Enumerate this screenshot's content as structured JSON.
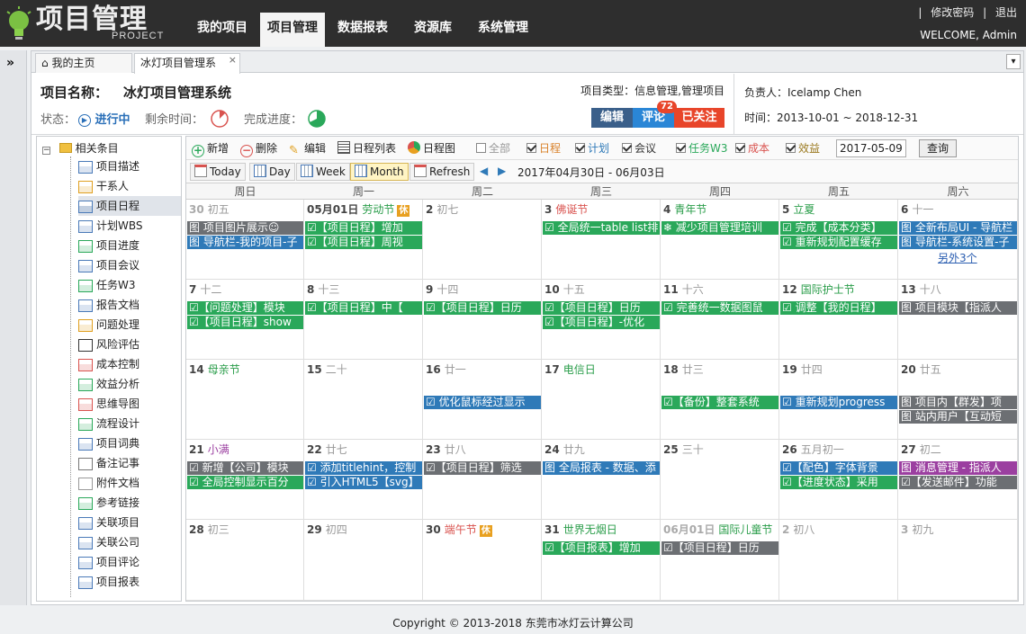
{
  "app": {
    "logo_main": "项目管理",
    "logo_sub": "PROJECT"
  },
  "nav": [
    "我的项目",
    "项目管理",
    "数据报表",
    "资源库",
    "系统管理"
  ],
  "top_links": {
    "change_password": "修改密码",
    "logout": "退出",
    "welcome": "WELCOME, Admin"
  },
  "tabs": [
    "我的主页",
    "冰灯项目管理系"
  ],
  "project": {
    "name_label": "项目名称：",
    "name": "冰灯项目管理系统",
    "status_label": "状态：",
    "status": "进行中",
    "remaining_label": "剩余时间：",
    "progress_label": "完成进度：",
    "type": "项目类型：信息管理,管理项目",
    "owner": "负责人：Icelamp Chen",
    "time": "时间：2013-10-01 ~ 2018-12-31",
    "edit_btn": "编辑",
    "comment_btn": "评论",
    "comment_count": "72",
    "follow_btn": "已关注"
  },
  "sidebar": {
    "root": "相关条目",
    "items": [
      "项目描述",
      "干系人",
      "项目日程",
      "计划WBS",
      "项目进度",
      "项目会议",
      "任务W3",
      "报告文档",
      "问题处理",
      "风险评估",
      "成本控制",
      "效益分析",
      "思维导图",
      "流程设计",
      "项目词典",
      "备注记事",
      "附件文档",
      "参考链接",
      "关联项目",
      "关联公司",
      "项目评论",
      "项目报表"
    ],
    "active_index": 2
  },
  "toolbar": {
    "add": "新增",
    "delete": "删除",
    "edit": "编辑",
    "list": "日程列表",
    "chart": "日程图",
    "filters": [
      {
        "label": "全部",
        "checked": false,
        "color": "#999999"
      },
      {
        "label": "日程",
        "checked": true,
        "color": "#d9822b"
      },
      {
        "label": "计划",
        "checked": true,
        "color": "#2f7ab8"
      },
      {
        "label": "会议",
        "checked": true,
        "color": "#333333"
      },
      {
        "label": "任务W3",
        "checked": true,
        "color": "#2aa85a"
      },
      {
        "label": "成本",
        "checked": true,
        "color": "#d9534f"
      },
      {
        "label": "效益",
        "checked": true,
        "color": "#9b7a20"
      }
    ],
    "date_value": "2017-05-09",
    "query": "查询",
    "views": [
      "Today",
      "Day",
      "Week",
      "Month",
      "Refresh"
    ],
    "active_view": "Month",
    "range": "2017年04月30日 - 06月03日"
  },
  "calendar": {
    "weekdays": [
      "周日",
      "周一",
      "周二",
      "周三",
      "周四",
      "周五",
      "周六"
    ],
    "weeks": [
      [
        {
          "d": "30",
          "l": "初五",
          "dim": true,
          "ev": [
            [
              "gray",
              "图 项目图片展示☺"
            ],
            [
              "blue",
              "图 导航栏-我的项目-子"
            ]
          ]
        },
        {
          "d": "05月01日",
          "f": "劳动节",
          "rest": "休",
          "ev": [
            [
              "green",
              "☑【项目日程】增加"
            ],
            [
              "green",
              "☑【项目日程】周视"
            ]
          ]
        },
        {
          "d": "2",
          "l": "初七",
          "ev": []
        },
        {
          "d": "3",
          "f": "佛诞节",
          "red": true,
          "ev": [
            [
              "green",
              "☑ 全局统一table list排"
            ]
          ]
        },
        {
          "d": "4",
          "f": "青年节",
          "ev": [
            [
              "green",
              "❄ 减少项目管理培训"
            ]
          ]
        },
        {
          "d": "5",
          "f": "立夏",
          "ev": [
            [
              "green",
              "☑ 完成【成本分类】"
            ],
            [
              "green",
              "☑ 重新规划配置缓存"
            ]
          ]
        },
        {
          "d": "6",
          "l": "十一",
          "ev": [
            [
              "blue",
              "图 全新布局UI - 导航栏"
            ],
            [
              "blue",
              "图 导航栏-系统设置-子"
            ]
          ],
          "more": "另外3个"
        }
      ],
      [
        {
          "d": "7",
          "l": "十二",
          "ev": [
            [
              "green",
              "☑【问题处理】模块"
            ],
            [
              "green",
              "☑【项目日程】show"
            ]
          ]
        },
        {
          "d": "8",
          "l": "十三",
          "ev": [
            [
              "green",
              "☑【项目日程】中【"
            ]
          ]
        },
        {
          "d": "9",
          "l": "十四",
          "ev": [
            [
              "green",
              "☑【项目日程】日历"
            ]
          ]
        },
        {
          "d": "10",
          "l": "十五",
          "ev": [
            [
              "green",
              "☑【项目日程】日历"
            ],
            [
              "green",
              "☑【项目日程】-优化"
            ]
          ]
        },
        {
          "d": "11",
          "l": "十六",
          "ev": [
            [
              "green",
              "☑ 完善统一数据图鼠"
            ]
          ]
        },
        {
          "d": "12",
          "f": "国际护士节",
          "ev": [
            [
              "green",
              "☑ 调整【我的日程】"
            ]
          ]
        },
        {
          "d": "13",
          "l": "十八",
          "ev": [
            [
              "gray",
              "图 项目模块【指派人"
            ]
          ]
        }
      ],
      [
        {
          "d": "14",
          "f": "母亲节",
          "ev": []
        },
        {
          "d": "15",
          "l": "二十",
          "ev": []
        },
        {
          "d": "16",
          "l": "廿一",
          "ev": [
            [],
            [
              "blue",
              "☑ 优化鼠标经过显示"
            ]
          ]
        },
        {
          "d": "17",
          "f": "电信日",
          "ev": []
        },
        {
          "d": "18",
          "l": "廿三",
          "ev": [
            [],
            [
              "green",
              "☑【备份】整套系统"
            ]
          ]
        },
        {
          "d": "19",
          "l": "廿四",
          "ev": [
            [],
            [
              "blue",
              "☑ 重新规划progress"
            ]
          ]
        },
        {
          "d": "20",
          "l": "廿五",
          "ev": [
            [],
            [
              "gray",
              "图 项目内【群发】项"
            ],
            [
              "gray",
              "图 站内用户【互动短"
            ]
          ]
        }
      ],
      [
        {
          "d": "21",
          "f": "小满",
          "purple": true,
          "ev": [
            [
              "gray",
              "☑ 新增【公司】模块"
            ],
            [
              "green",
              "☑ 全局控制显示百分"
            ]
          ]
        },
        {
          "d": "22",
          "l": "廿七",
          "ev": [
            [
              "blue",
              "☑ 添加titlehint，控制"
            ],
            [
              "blue",
              "☑ 引入HTML5【svg】"
            ]
          ]
        },
        {
          "d": "23",
          "l": "廿八",
          "ev": [
            [
              "gray",
              "☑【项目日程】筛选"
            ]
          ]
        },
        {
          "d": "24",
          "l": "廿九",
          "ev": [
            [
              "blue",
              "图 全局报表 - 数据、添"
            ]
          ]
        },
        {
          "d": "25",
          "l": "三十",
          "ev": []
        },
        {
          "d": "26",
          "l": "五月初一",
          "ev": [
            [
              "blue",
              "☑【配色】字体背景"
            ],
            [
              "green",
              "☑【进度状态】采用"
            ]
          ]
        },
        {
          "d": "27",
          "l": "初二",
          "ev": [
            [
              "purple",
              "图 消息管理 - 指派人"
            ],
            [
              "gray",
              "☑【发送邮件】功能"
            ]
          ]
        }
      ],
      [
        {
          "d": "28",
          "l": "初三",
          "ev": []
        },
        {
          "d": "29",
          "l": "初四",
          "ev": []
        },
        {
          "d": "30",
          "f": "端午节",
          "red": true,
          "rest": "休",
          "ev": []
        },
        {
          "d": "31",
          "f": "世界无烟日",
          "ev": [
            [
              "green",
              "☑【项目报表】增加"
            ]
          ]
        },
        {
          "d": "06月01日",
          "f": "国际儿童节",
          "dim": true,
          "ev": [
            [
              "gray",
              "☑【项目日程】日历"
            ]
          ]
        },
        {
          "d": "2",
          "l": "初八",
          "dim": true,
          "ev": []
        },
        {
          "d": "3",
          "l": "初九",
          "dim": true,
          "ev": []
        }
      ]
    ]
  },
  "footer": "Copyright © 2013-2018 东莞市冰灯云计算公司",
  "colors": {
    "topbar": "#2e2e2e",
    "green": "#2aa85a",
    "blue": "#2f7ab8",
    "gray": "#6c6f73",
    "purple": "#9b3fa0",
    "edit": "#3a5f8a",
    "comment": "#2a86d6",
    "follow": "#e8452a"
  }
}
